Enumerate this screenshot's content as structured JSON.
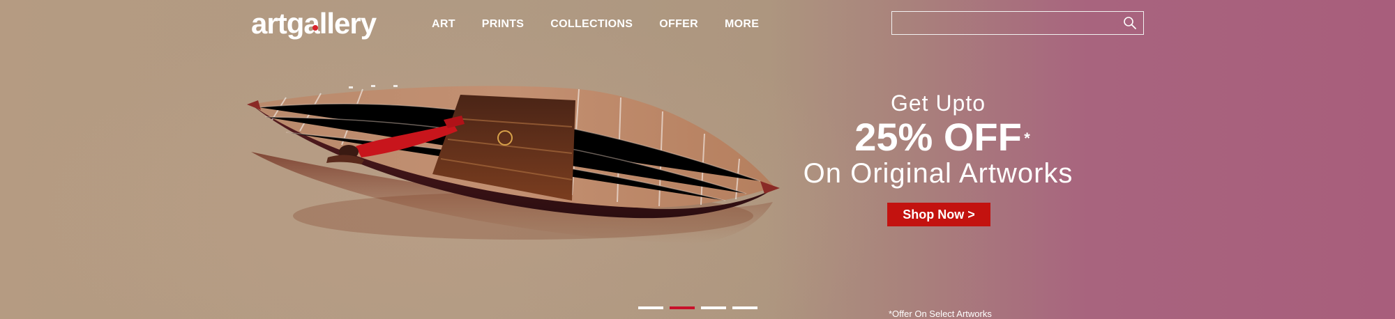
{
  "header": {
    "logo_text": "artgallery",
    "logo_dot_color": "#d8232a",
    "nav": [
      "ART",
      "PRINTS",
      "COLLECTIONS",
      "OFFER",
      "MORE"
    ],
    "search": {
      "placeholder": "",
      "icon": "search-icon"
    }
  },
  "hero": {
    "painting": "boat-painting",
    "promo": {
      "line1": "Get Upto",
      "line2": "25% OFF",
      "asterisk": "*",
      "line3": "On Original Artworks"
    },
    "cta_label": "Shop Now >",
    "cta_color": "#c3120f",
    "footnote": "*Offer On Select Artworks"
  },
  "carousel": {
    "slide_count": 4,
    "active_index": 1,
    "active_color": "#c8112a"
  }
}
